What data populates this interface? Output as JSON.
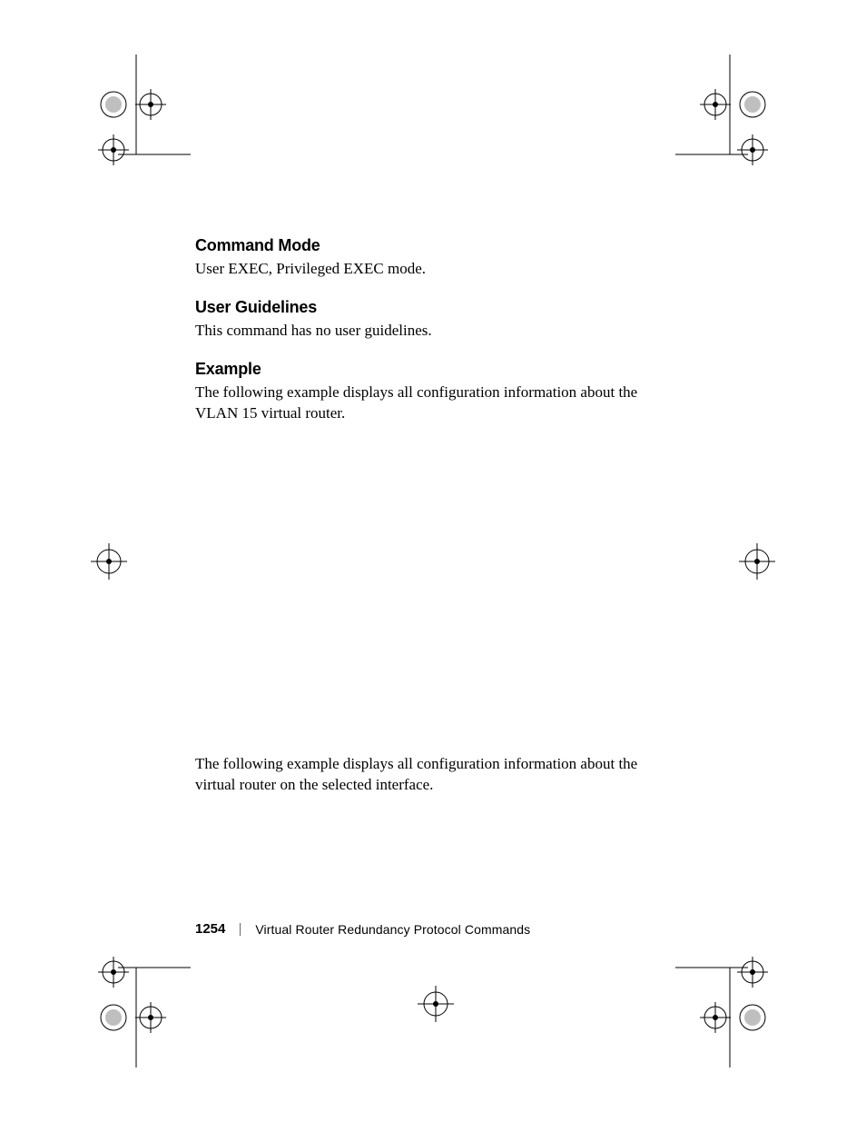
{
  "sections": {
    "command_mode": {
      "heading": "Command Mode",
      "body": "User EXEC, Privileged EXEC mode."
    },
    "user_guidelines": {
      "heading": "User Guidelines",
      "body": "This command has no user guidelines."
    },
    "example": {
      "heading": "Example",
      "body1": "The following example displays all configuration information about the VLAN 15 virtual router.",
      "body2": "The following example displays all configuration information about the virtual router on the selected interface."
    }
  },
  "footer": {
    "page_number": "1254",
    "title": "Virtual Router Redundancy Protocol Commands"
  }
}
